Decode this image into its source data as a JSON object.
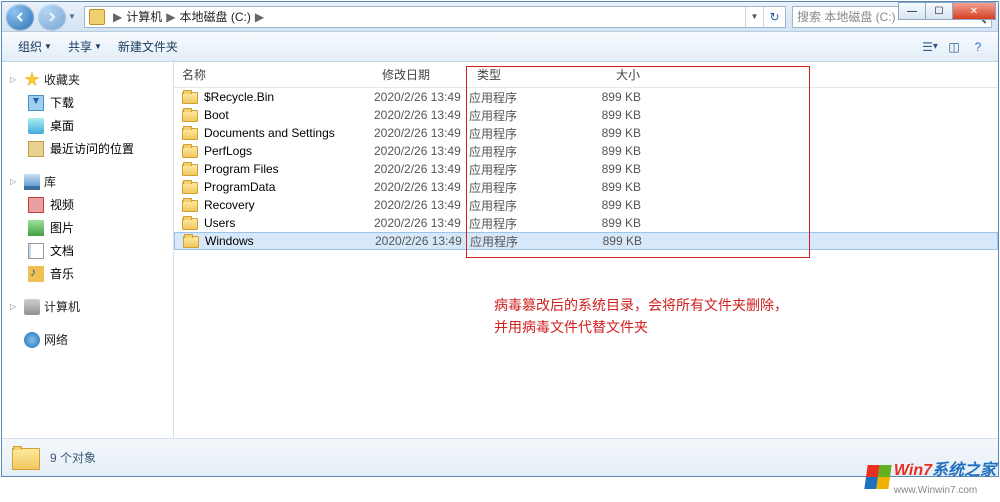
{
  "window": {
    "min": "—",
    "max": "☐",
    "close": "✕"
  },
  "address": {
    "root": "计算机",
    "sep": "▶",
    "current": "本地磁盘 (C:)"
  },
  "search": {
    "placeholder": "搜索 本地磁盘 (C:)"
  },
  "toolbar": {
    "organize": "组织",
    "share": "共享",
    "newfolder": "新建文件夹"
  },
  "sidebar": {
    "favorites": "收藏夹",
    "downloads": "下载",
    "desktop": "桌面",
    "recent": "最近访问的位置",
    "libraries": "库",
    "videos": "视频",
    "pictures": "图片",
    "documents": "文档",
    "music": "音乐",
    "computer": "计算机",
    "network": "网络"
  },
  "columns": {
    "name": "名称",
    "date": "修改日期",
    "type": "类型",
    "size": "大小"
  },
  "files": [
    {
      "name": "$Recycle.Bin",
      "date": "2020/2/26 13:49",
      "type": "应用程序",
      "size": "899 KB"
    },
    {
      "name": "Boot",
      "date": "2020/2/26 13:49",
      "type": "应用程序",
      "size": "899 KB"
    },
    {
      "name": "Documents and Settings",
      "date": "2020/2/26 13:49",
      "type": "应用程序",
      "size": "899 KB"
    },
    {
      "name": "PerfLogs",
      "date": "2020/2/26 13:49",
      "type": "应用程序",
      "size": "899 KB"
    },
    {
      "name": "Program Files",
      "date": "2020/2/26 13:49",
      "type": "应用程序",
      "size": "899 KB"
    },
    {
      "name": "ProgramData",
      "date": "2020/2/26 13:49",
      "type": "应用程序",
      "size": "899 KB"
    },
    {
      "name": "Recovery",
      "date": "2020/2/26 13:49",
      "type": "应用程序",
      "size": "899 KB"
    },
    {
      "name": "Users",
      "date": "2020/2/26 13:49",
      "type": "应用程序",
      "size": "899 KB"
    },
    {
      "name": "Windows",
      "date": "2020/2/26 13:49",
      "type": "应用程序",
      "size": "899 KB",
      "selected": true
    }
  ],
  "annotation": {
    "line1": "病毒篡改后的系统目录，会将所有文件夹删除，",
    "line2": "并用病毒文件代替文件夹"
  },
  "status": {
    "count": "9 个对象"
  },
  "watermark": {
    "t1": "Win7",
    "t2": "系统之家",
    "sub": "www.Winwin7.com"
  }
}
